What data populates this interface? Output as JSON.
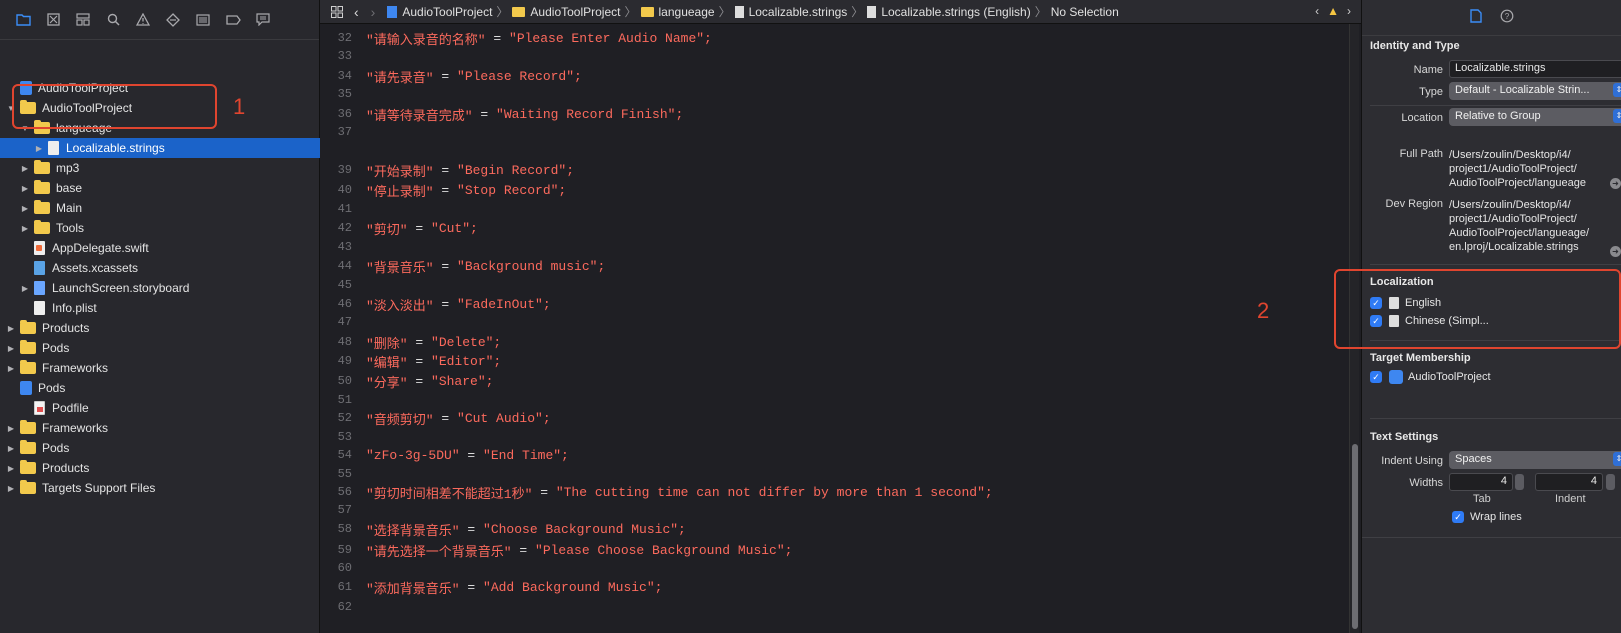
{
  "navigator": {
    "toolbar_icons": [
      "folder-icon",
      "source-control-icon",
      "symbol-icon",
      "search-icon",
      "warning-icon",
      "test-icon",
      "debug-icon",
      "breakpoint-icon",
      "report-icon"
    ],
    "items": [
      {
        "label": "AudioToolProject",
        "kind": "project",
        "level": 0,
        "disclosure": ""
      },
      {
        "label": "AudioToolProject",
        "kind": "folder",
        "level": 0,
        "disclosure": "▼"
      },
      {
        "label": "langueage",
        "kind": "folder",
        "level": 1,
        "disclosure": "▼"
      },
      {
        "label": "Localizable.strings",
        "kind": "strings",
        "level": 2,
        "disclosure": "▶",
        "selected": true
      },
      {
        "label": "mp3",
        "kind": "folder",
        "level": 1,
        "disclosure": "▶"
      },
      {
        "label": "base",
        "kind": "folder",
        "level": 1,
        "disclosure": "▶"
      },
      {
        "label": "Main",
        "kind": "folder",
        "level": 1,
        "disclosure": "▶"
      },
      {
        "label": "Tools",
        "kind": "folder",
        "level": 1,
        "disclosure": "▶"
      },
      {
        "label": "AppDelegate.swift",
        "kind": "swift",
        "level": 1,
        "disclosure": ""
      },
      {
        "label": "Assets.xcassets",
        "kind": "assets",
        "level": 1,
        "disclosure": ""
      },
      {
        "label": "LaunchScreen.storyboard",
        "kind": "storyboard",
        "level": 1,
        "disclosure": "▶"
      },
      {
        "label": "Info.plist",
        "kind": "plist",
        "level": 1,
        "disclosure": ""
      },
      {
        "label": "Products",
        "kind": "folder",
        "level": 0,
        "disclosure": "▶"
      },
      {
        "label": "Pods",
        "kind": "folder",
        "level": 0,
        "disclosure": "▶"
      },
      {
        "label": "Frameworks",
        "kind": "folder",
        "level": 0,
        "disclosure": "▶"
      },
      {
        "label": "Pods",
        "kind": "project",
        "level": 0,
        "disclosure": ""
      },
      {
        "label": "Podfile",
        "kind": "podfile",
        "level": 1,
        "disclosure": ""
      },
      {
        "label": "Frameworks",
        "kind": "folder",
        "level": 0,
        "disclosure": "▶"
      },
      {
        "label": "Pods",
        "kind": "folder",
        "level": 0,
        "disclosure": "▶"
      },
      {
        "label": "Products",
        "kind": "folder",
        "level": 0,
        "disclosure": "▶"
      },
      {
        "label": "Targets Support Files",
        "kind": "folder",
        "level": 0,
        "disclosure": "▶"
      }
    ],
    "annotation_label": "1"
  },
  "jumpbar": {
    "crumbs": [
      "AudioToolProject",
      "AudioToolProject",
      "langueage",
      "Localizable.strings",
      "Localizable.strings (English)",
      "No Selection"
    ]
  },
  "editor": {
    "lines": [
      {
        "n": "32",
        "key": "\"请输入录音的名称\"",
        "value": "\"Please Enter Audio Name\";"
      },
      {
        "n": "33",
        "key": "",
        "value": ""
      },
      {
        "n": "34",
        "key": "\"请先录音\"",
        "value": "\"Please Record\";"
      },
      {
        "n": "35",
        "key": "",
        "value": ""
      },
      {
        "n": "36",
        "key": "\"请等待录音完成\"",
        "value": "\"Waiting Record Finish\";"
      },
      {
        "n": "37",
        "key": "",
        "value": ""
      },
      {
        "n": "",
        "key": "",
        "value": ""
      },
      {
        "n": "39",
        "key": "\"开始录制\"",
        "value": "\"Begin Record\";"
      },
      {
        "n": "40",
        "key": "\"停止录制\"",
        "value": "\"Stop Record\";"
      },
      {
        "n": "41",
        "key": "",
        "value": ""
      },
      {
        "n": "42",
        "key": "\"剪切\"",
        "value": "\"Cut\";"
      },
      {
        "n": "43",
        "key": "",
        "value": ""
      },
      {
        "n": "44",
        "key": "\"背景音乐\"",
        "value": "\"Background music\";"
      },
      {
        "n": "45",
        "key": "",
        "value": ""
      },
      {
        "n": "46",
        "key": "\"淡入淡出\"",
        "value": "\"FadeInOut\";"
      },
      {
        "n": "47",
        "key": "",
        "value": ""
      },
      {
        "n": "48",
        "key": "\"删除\"",
        "value": "\"Delete\";"
      },
      {
        "n": "49",
        "key": "\"编辑\"",
        "value": "\"Editor\";"
      },
      {
        "n": "50",
        "key": "\"分享\"",
        "value": "\"Share\";"
      },
      {
        "n": "51",
        "key": "",
        "value": ""
      },
      {
        "n": "52",
        "key": "\"音频剪切\"",
        "value": "\"Cut Audio\";"
      },
      {
        "n": "53",
        "key": "",
        "value": ""
      },
      {
        "n": "54",
        "key": "\"zFo-3g-5DU\"",
        "value": "\"End Time\";"
      },
      {
        "n": "55",
        "key": "",
        "value": ""
      },
      {
        "n": "56",
        "key": "\"剪切时间相差不能超过1秒\"",
        "value": "\"The cutting time can not differ by more than 1 second\";"
      },
      {
        "n": "57",
        "key": "",
        "value": ""
      },
      {
        "n": "58",
        "key": "\"选择背景音乐\"",
        "value": "\"Choose Background Music\";"
      },
      {
        "n": "59",
        "key": "\"请先选择一个背景音乐\"",
        "value": "\"Please Choose Background Music\";"
      },
      {
        "n": "60",
        "key": "",
        "value": ""
      },
      {
        "n": "61",
        "key": "\"添加背景音乐\"",
        "value": "\"Add Background Music\";"
      },
      {
        "n": "62",
        "key": "",
        "value": ""
      }
    ],
    "annotation_label": "2"
  },
  "inspector": {
    "identity": {
      "title": "Identity and Type",
      "name_label": "Name",
      "name_value": "Localizable.strings",
      "type_label": "Type",
      "type_value": "Default - Localizable Strin...",
      "location_label": "Location",
      "location_value": "Relative to Group",
      "fullpath_label": "Full Path",
      "fullpath_value": [
        "/Users/zoulin/Desktop/i4/",
        "project1/AudioToolProject/",
        "AudioToolProject/langueage"
      ],
      "devregion_label": "Dev Region",
      "devregion_value": [
        "/Users/zoulin/Desktop/i4/",
        "project1/AudioToolProject/",
        "AudioToolProject/langueage/",
        "en.lproj/Localizable.strings"
      ]
    },
    "localization": {
      "title": "Localization",
      "items": [
        {
          "label": "English",
          "checked": true
        },
        {
          "label": "Chinese (Simpl...",
          "checked": true
        }
      ]
    },
    "target": {
      "title": "Target Membership",
      "items": [
        {
          "label": "AudioToolProject",
          "checked": true
        }
      ]
    },
    "text_settings": {
      "title": "Text Settings",
      "indent_label": "Indent Using",
      "indent_value": "Spaces",
      "widths_label": "Widths",
      "tab_value": "4",
      "indent_width_value": "4",
      "tab_caption": "Tab",
      "indent_caption": "Indent",
      "wrap_label": "Wrap lines",
      "wrap_checked": true
    }
  },
  "colors": {
    "accent": "#1b63c9",
    "string_literal": "#fc6a5d",
    "annotation": "#e0452f"
  }
}
